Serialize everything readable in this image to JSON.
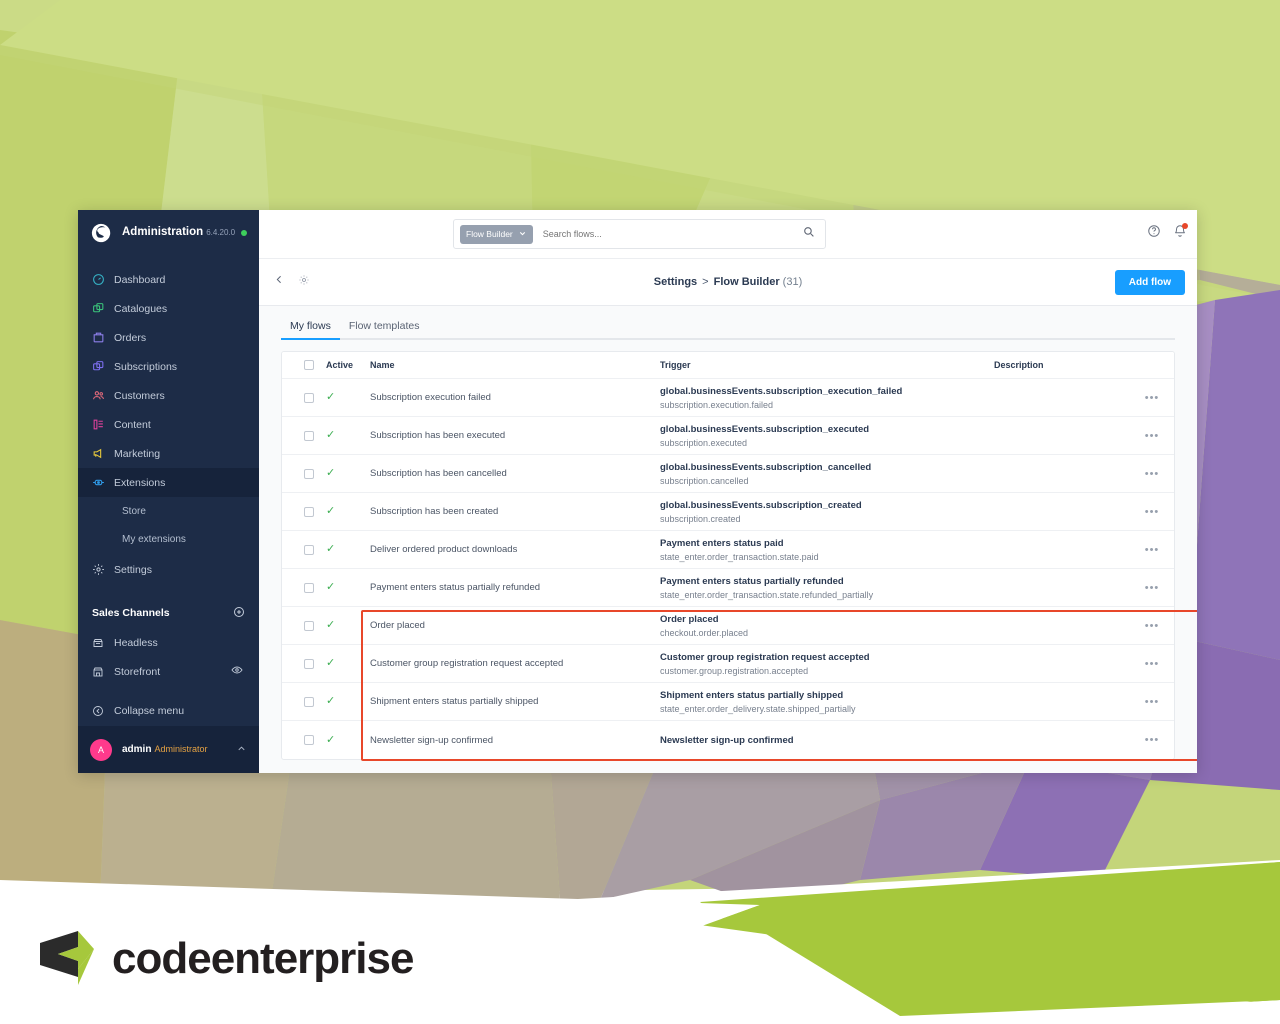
{
  "brand": {
    "name": "codeenterprise"
  },
  "sidebar": {
    "title": "Administration",
    "version": "6.4.20.0",
    "logo_icon": "shopware-logo-icon",
    "status_dot": "online-status-dot",
    "items": [
      {
        "label": "Dashboard",
        "icon": "dashboard-icon",
        "color": "#35b1c4"
      },
      {
        "label": "Catalogues",
        "icon": "catalogues-icon",
        "color": "#3ac27a"
      },
      {
        "label": "Orders",
        "icon": "orders-icon",
        "color": "#8b7ee8"
      },
      {
        "label": "Subscriptions",
        "icon": "subscriptions-icon",
        "color": "#7d6ff0"
      },
      {
        "label": "Customers",
        "icon": "customers-icon",
        "color": "#e0697a"
      },
      {
        "label": "Content",
        "icon": "content-icon",
        "color": "#e0419b"
      },
      {
        "label": "Marketing",
        "icon": "marketing-icon",
        "color": "#e8c93c"
      },
      {
        "label": "Extensions",
        "icon": "extensions-icon",
        "color": "#2f9ae8",
        "active": true
      }
    ],
    "extension_children": [
      {
        "label": "Store"
      },
      {
        "label": "My extensions"
      }
    ],
    "settings": {
      "label": "Settings",
      "icon": "gear-icon"
    },
    "sales_channels": {
      "label": "Sales Channels",
      "add_icon": "plus-circle-icon"
    },
    "channels": [
      {
        "label": "Headless",
        "icon": "headless-icon"
      },
      {
        "label": "Storefront",
        "icon": "storefront-icon",
        "trailing_icon": "eye-icon"
      }
    ],
    "collapse": {
      "label": "Collapse menu",
      "icon": "collapse-icon"
    },
    "user": {
      "initial": "A",
      "name": "admin",
      "role": "Administrator",
      "chevron_icon": "chevron-up-icon"
    }
  },
  "topbar": {
    "search_chip": "Flow Builder",
    "search_chip_icon": "chevron-down-icon",
    "search_placeholder": "Search flows...",
    "search_icon": "search-icon",
    "help_icon": "help-circle-icon",
    "notification_icon": "bell-icon"
  },
  "breadcrumb": {
    "back_icon": "chevron-left-icon",
    "settings_icon": "gear-icon",
    "parent": "Settings",
    "separator": ">",
    "current": "Flow Builder",
    "count": "(31)",
    "add_button": "Add flow"
  },
  "tabs": [
    {
      "label": "My flows",
      "selected": true
    },
    {
      "label": "Flow templates",
      "selected": false
    }
  ],
  "table": {
    "columns": {
      "active": "Active",
      "name": "Name",
      "trigger": "Trigger",
      "description": "Description"
    },
    "more_glyph": "•••",
    "tick_glyph": "✓",
    "rows": [
      {
        "name": "Subscription execution failed",
        "trigger_main": "global.businessEvents.subscription_execution_failed",
        "trigger_sub": "subscription.execution.failed",
        "description": "",
        "active": true,
        "highlighted": true
      },
      {
        "name": "Subscription has been executed",
        "trigger_main": "global.businessEvents.subscription_executed",
        "trigger_sub": "subscription.executed",
        "description": "",
        "active": true,
        "highlighted": true
      },
      {
        "name": "Subscription has been cancelled",
        "trigger_main": "global.businessEvents.subscription_cancelled",
        "trigger_sub": "subscription.cancelled",
        "description": "",
        "active": true,
        "highlighted": true
      },
      {
        "name": "Subscription has been created",
        "trigger_main": "global.businessEvents.subscription_created",
        "trigger_sub": "subscription.created",
        "description": "",
        "active": true,
        "highlighted": true
      },
      {
        "name": "Deliver ordered product downloads",
        "trigger_main": "Payment enters status paid",
        "trigger_sub": "state_enter.order_transaction.state.paid",
        "description": "",
        "active": true,
        "highlighted": false
      },
      {
        "name": "Payment enters status partially refunded",
        "trigger_main": "Payment enters status partially refunded",
        "trigger_sub": "state_enter.order_transaction.state.refunded_partially",
        "description": "",
        "active": true,
        "highlighted": false
      },
      {
        "name": "Order placed",
        "trigger_main": "Order placed",
        "trigger_sub": "checkout.order.placed",
        "description": "",
        "active": true,
        "highlighted": false
      },
      {
        "name": "Customer group registration request accepted",
        "trigger_main": "Customer group registration request accepted",
        "trigger_sub": "customer.group.registration.accepted",
        "description": "",
        "active": true,
        "highlighted": false
      },
      {
        "name": "Shipment enters status partially shipped",
        "trigger_main": "Shipment enters status partially shipped",
        "trigger_sub": "state_enter.order_delivery.state.shipped_partially",
        "description": "",
        "active": true,
        "highlighted": false
      },
      {
        "name": "Newsletter sign-up confirmed",
        "trigger_main": "Newsletter sign-up confirmed",
        "trigger_sub": "",
        "description": "",
        "active": true,
        "highlighted": false
      }
    ]
  },
  "annotation": {
    "color": "#e8472a",
    "label": "highlight-box-subscription-flows"
  },
  "colors": {
    "accent": "#189eff",
    "sidebar_bg": "#1d2c47",
    "sidebar_active": "#16233b",
    "tick_green": "#3dae52",
    "brand_green": "#a6c83c",
    "annotation_red": "#e8472a"
  }
}
